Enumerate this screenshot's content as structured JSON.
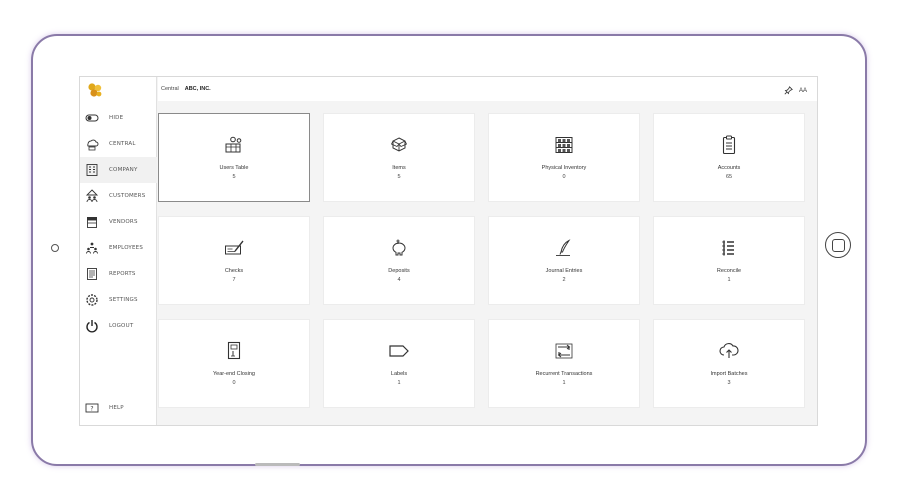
{
  "topbar": {
    "section": "Central",
    "company": "ABC, INC.",
    "font_size_label": "AA"
  },
  "sidebar": {
    "items": [
      {
        "label": "HIDE",
        "icon": "toggle-icon"
      },
      {
        "label": "CENTRAL",
        "icon": "cloud-computer-icon"
      },
      {
        "label": "COMPANY",
        "icon": "building-icon",
        "active": true
      },
      {
        "label": "CUSTOMERS",
        "icon": "customers-icon"
      },
      {
        "label": "VENDORS",
        "icon": "store-icon"
      },
      {
        "label": "EMPLOYEES",
        "icon": "employees-icon"
      },
      {
        "label": "REPORTS",
        "icon": "report-icon"
      },
      {
        "label": "SETTINGS",
        "icon": "gear-icon"
      },
      {
        "label": "LOGOUT",
        "icon": "power-icon"
      }
    ],
    "help": "HELP"
  },
  "tiles": [
    {
      "label": "Users Table",
      "count": "5",
      "icon": "users-table-icon",
      "selected": true
    },
    {
      "label": "Items",
      "count": "5",
      "icon": "items-box-icon"
    },
    {
      "label": "Physical Inventory",
      "count": "0",
      "icon": "inventory-shelf-icon"
    },
    {
      "label": "Accounts",
      "count": "65",
      "icon": "clipboard-icon"
    },
    {
      "label": "Checks",
      "count": "7",
      "icon": "check-writing-icon"
    },
    {
      "label": "Deposits",
      "count": "4",
      "icon": "piggy-bank-icon"
    },
    {
      "label": "Journal Entries",
      "count": "2",
      "icon": "quill-pen-icon"
    },
    {
      "label": "Reconcile",
      "count": "1",
      "icon": "checklist-icon"
    },
    {
      "label": "Year-end Closing",
      "count": "0",
      "icon": "year-end-book-icon"
    },
    {
      "label": "Labels",
      "count": "1",
      "icon": "label-tag-icon"
    },
    {
      "label": "Recurrent Transactions",
      "count": "1",
      "icon": "recurring-icon"
    },
    {
      "label": "Import Batches",
      "count": "3",
      "icon": "cloud-upload-icon"
    }
  ],
  "colors": {
    "frame_border": "#8a7aa8",
    "logo": "#e0a81a",
    "tile_bg": "#ffffff",
    "screen_bg": "#f4f4f4"
  }
}
